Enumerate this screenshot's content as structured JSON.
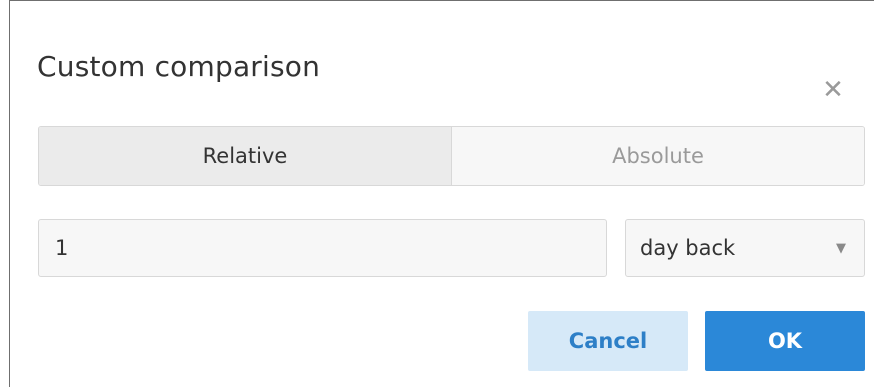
{
  "dialog": {
    "title": "Custom comparison",
    "close_icon": "close-icon",
    "close_glyph": "✕"
  },
  "mode_toggle": {
    "options": [
      {
        "label": "Relative",
        "selected": true
      },
      {
        "label": "Absolute",
        "selected": false
      }
    ]
  },
  "comparison": {
    "amount_value": "1",
    "unit_selected": "day back",
    "unit_dropdown_icon": "chevron-down-icon",
    "unit_dropdown_glyph": "▼"
  },
  "actions": {
    "cancel_label": "Cancel",
    "ok_label": "OK"
  },
  "colors": {
    "primary": "#2b88d8",
    "secondary_bg": "#d6e9f8",
    "secondary_text": "#2d7fc7"
  }
}
